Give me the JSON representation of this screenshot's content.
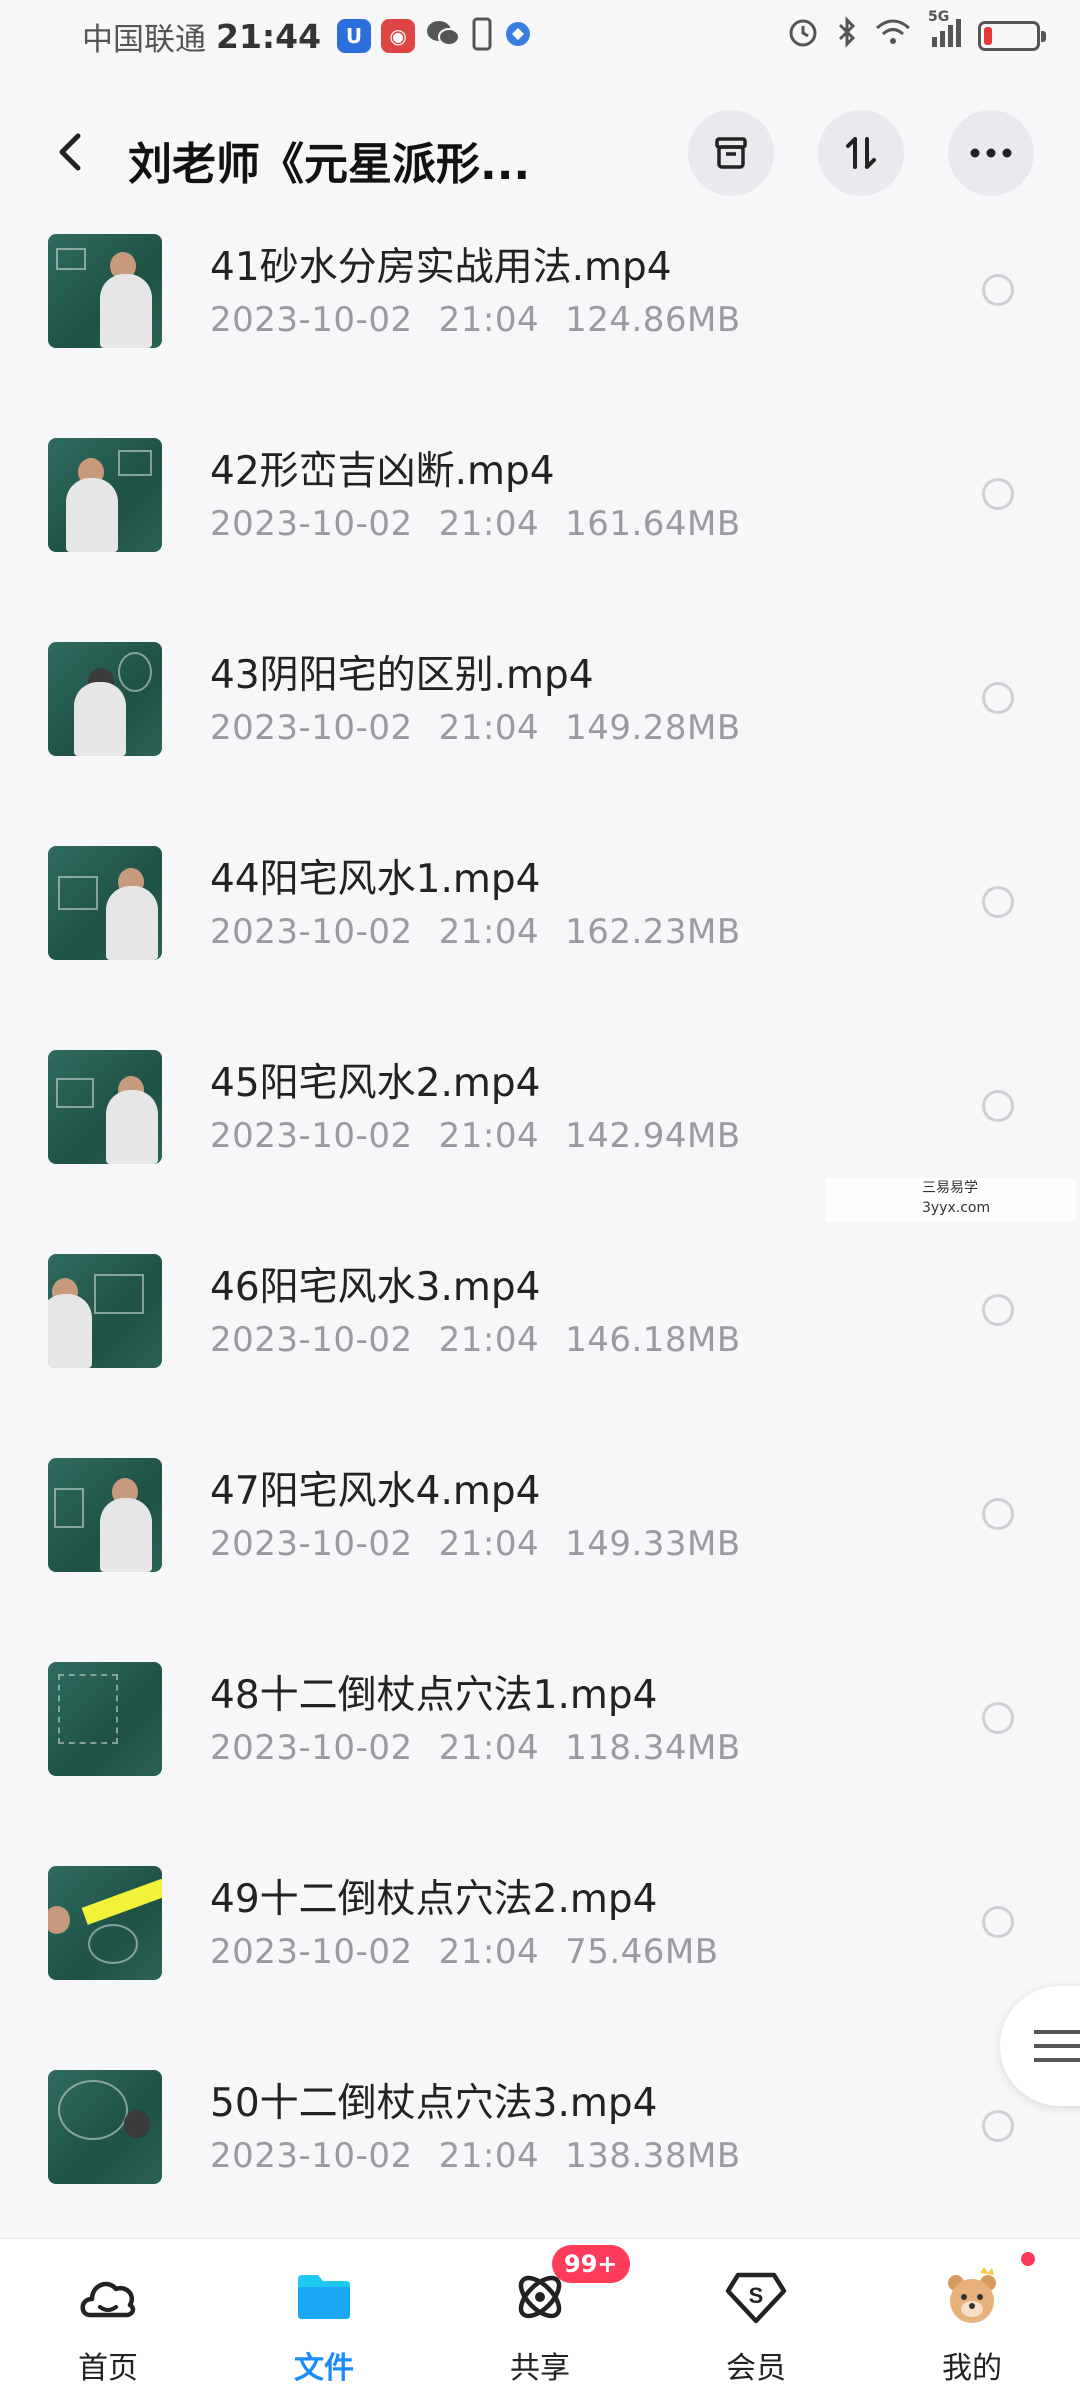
{
  "status_bar": {
    "carrier": "中国联通",
    "time": "21:44",
    "network": "5G",
    "battery_level": 0.15
  },
  "header": {
    "title": "刘老师《元星派形..."
  },
  "files": [
    {
      "name": "41砂水分房实战用法.mp4",
      "date": "2023-10-02",
      "time": "21:04",
      "size": "124.86MB"
    },
    {
      "name": "42形峦吉凶断.mp4",
      "date": "2023-10-02",
      "time": "21:04",
      "size": "161.64MB"
    },
    {
      "name": "43阴阳宅的区别.mp4",
      "date": "2023-10-02",
      "time": "21:04",
      "size": "149.28MB"
    },
    {
      "name": "44阳宅风水1.mp4",
      "date": "2023-10-02",
      "time": "21:04",
      "size": "162.23MB"
    },
    {
      "name": "45阳宅风水2.mp4",
      "date": "2023-10-02",
      "time": "21:04",
      "size": "142.94MB"
    },
    {
      "name": "46阳宅风水3.mp4",
      "date": "2023-10-02",
      "time": "21:04",
      "size": "146.18MB"
    },
    {
      "name": "47阳宅风水4.mp4",
      "date": "2023-10-02",
      "time": "21:04",
      "size": "149.33MB"
    },
    {
      "name": "48十二倒杖点穴法1.mp4",
      "date": "2023-10-02",
      "time": "21:04",
      "size": "118.34MB"
    },
    {
      "name": "49十二倒杖点穴法2.mp4",
      "date": "2023-10-02",
      "time": "21:04",
      "size": "75.46MB"
    },
    {
      "name": "50十二倒杖点穴法3.mp4",
      "date": "2023-10-02",
      "time": "21:04",
      "size": "138.38MB"
    }
  ],
  "watermark": {
    "line1": "三易易学",
    "line2": "3yyx.com"
  },
  "bottom_nav": {
    "home": "首页",
    "files": "文件",
    "share": "共享",
    "member": "会员",
    "mine": "我的",
    "share_badge": "99+"
  },
  "colors": {
    "accent": "#1a8cff",
    "badge": "#ff3b5c",
    "meta_text": "#9a9aa0"
  }
}
